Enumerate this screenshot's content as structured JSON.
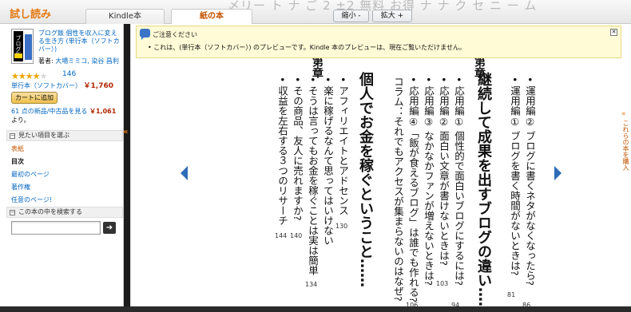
{
  "header": {
    "logo_prefix": "試し",
    "logo_suffix": "読み",
    "tabs": [
      {
        "label": "Kindle本",
        "active": false
      },
      {
        "label": "紙の本",
        "active": true
      }
    ],
    "zoom_out": "縮小 -",
    "zoom_in": "拡大 +",
    "background_text": "〆リー  ト ナ ご 2 ±2  無料 お得 ナ ナ  ク セ ニ ー ム"
  },
  "book": {
    "title": "ブログ飯 個性を収入に変える生き方 (単行本（ソフトカバー）)",
    "author_label": "著者:",
    "authors": "大場ミミコ, 染谷 昌利",
    "rating": 4,
    "rating_max": 5,
    "review_count": "146",
    "format": "単行本（ソフトカバー）",
    "price": "￥1,760",
    "add_to_cart": "カートに追加",
    "offers_link": "61 点の新品/中古品を見る",
    "offers_price": "￥1,061",
    "offers_suffix": "より。",
    "cover_text": "ブログ飯"
  },
  "sidebar": {
    "browse_header": "見たい項目を選ぶ",
    "items": [
      {
        "label": "表紙",
        "state": "current"
      },
      {
        "label": "目次",
        "state": "bold"
      },
      {
        "label": "最初のページ",
        "state": "link"
      },
      {
        "label": "著作権",
        "state": "link"
      },
      {
        "label": "任意のページ!",
        "state": "link"
      }
    ],
    "search_header": "この本の中を検索する",
    "search_value": "",
    "search_go": "➜",
    "collapse": "«"
  },
  "notice": {
    "title": "ご注意ください",
    "body": "• これは、(単行本（ソフトカバー）) のプレビューです。Kindle 本のプレビューは、現在ご覧いただけません。",
    "close": "✕"
  },
  "page": {
    "chapter_a": "第章",
    "chapter_b": "第章",
    "columns": [
      {
        "text": "• 運用編② ブログに書くネタがなくなったら?",
        "style": "md"
      },
      {
        "text": "• 運用編① ブログを書く時間がないときは?",
        "style": "md"
      },
      {
        "text": "継続して成果を出すブログの違い……",
        "style": "big"
      },
      {
        "text": "• 応用編① 個性的で面白いブログにするには?",
        "style": "md"
      },
      {
        "text": "• 応用編② 面白い文章が書けないときは?",
        "style": "md"
      },
      {
        "text": "• 応用編③ なかなかファンが増えないときは?",
        "style": "md"
      },
      {
        "text": "• 応用編④「飯が食えるブログ」は誰でも作れる?",
        "style": "md"
      },
      {
        "text": "コラム：それでもアクセスが集まらないのはなぜ?",
        "style": "md"
      },
      {
        "text": "個人でお金を稼ぐということ……",
        "style": "big"
      },
      {
        "text": "• アフィリエイトとアドセンス",
        "style": "md"
      },
      {
        "text": "• 楽に稼げるなんて思ってはいけない",
        "style": "md"
      },
      {
        "text": "• そうは言ってもお金を稼ぐことは実は簡単",
        "style": "md"
      },
      {
        "text": "• その商品、友人に売れますか?",
        "style": "md"
      },
      {
        "text": "• 収益を左右する３つのリサーチ",
        "style": "md"
      }
    ],
    "page_numbers": [
      "86",
      "81",
      "94",
      "103",
      "106",
      "130",
      "134",
      "140",
      "144"
    ]
  },
  "right_panel": {
    "chevron": "«",
    "text": "これらの本を購入"
  }
}
